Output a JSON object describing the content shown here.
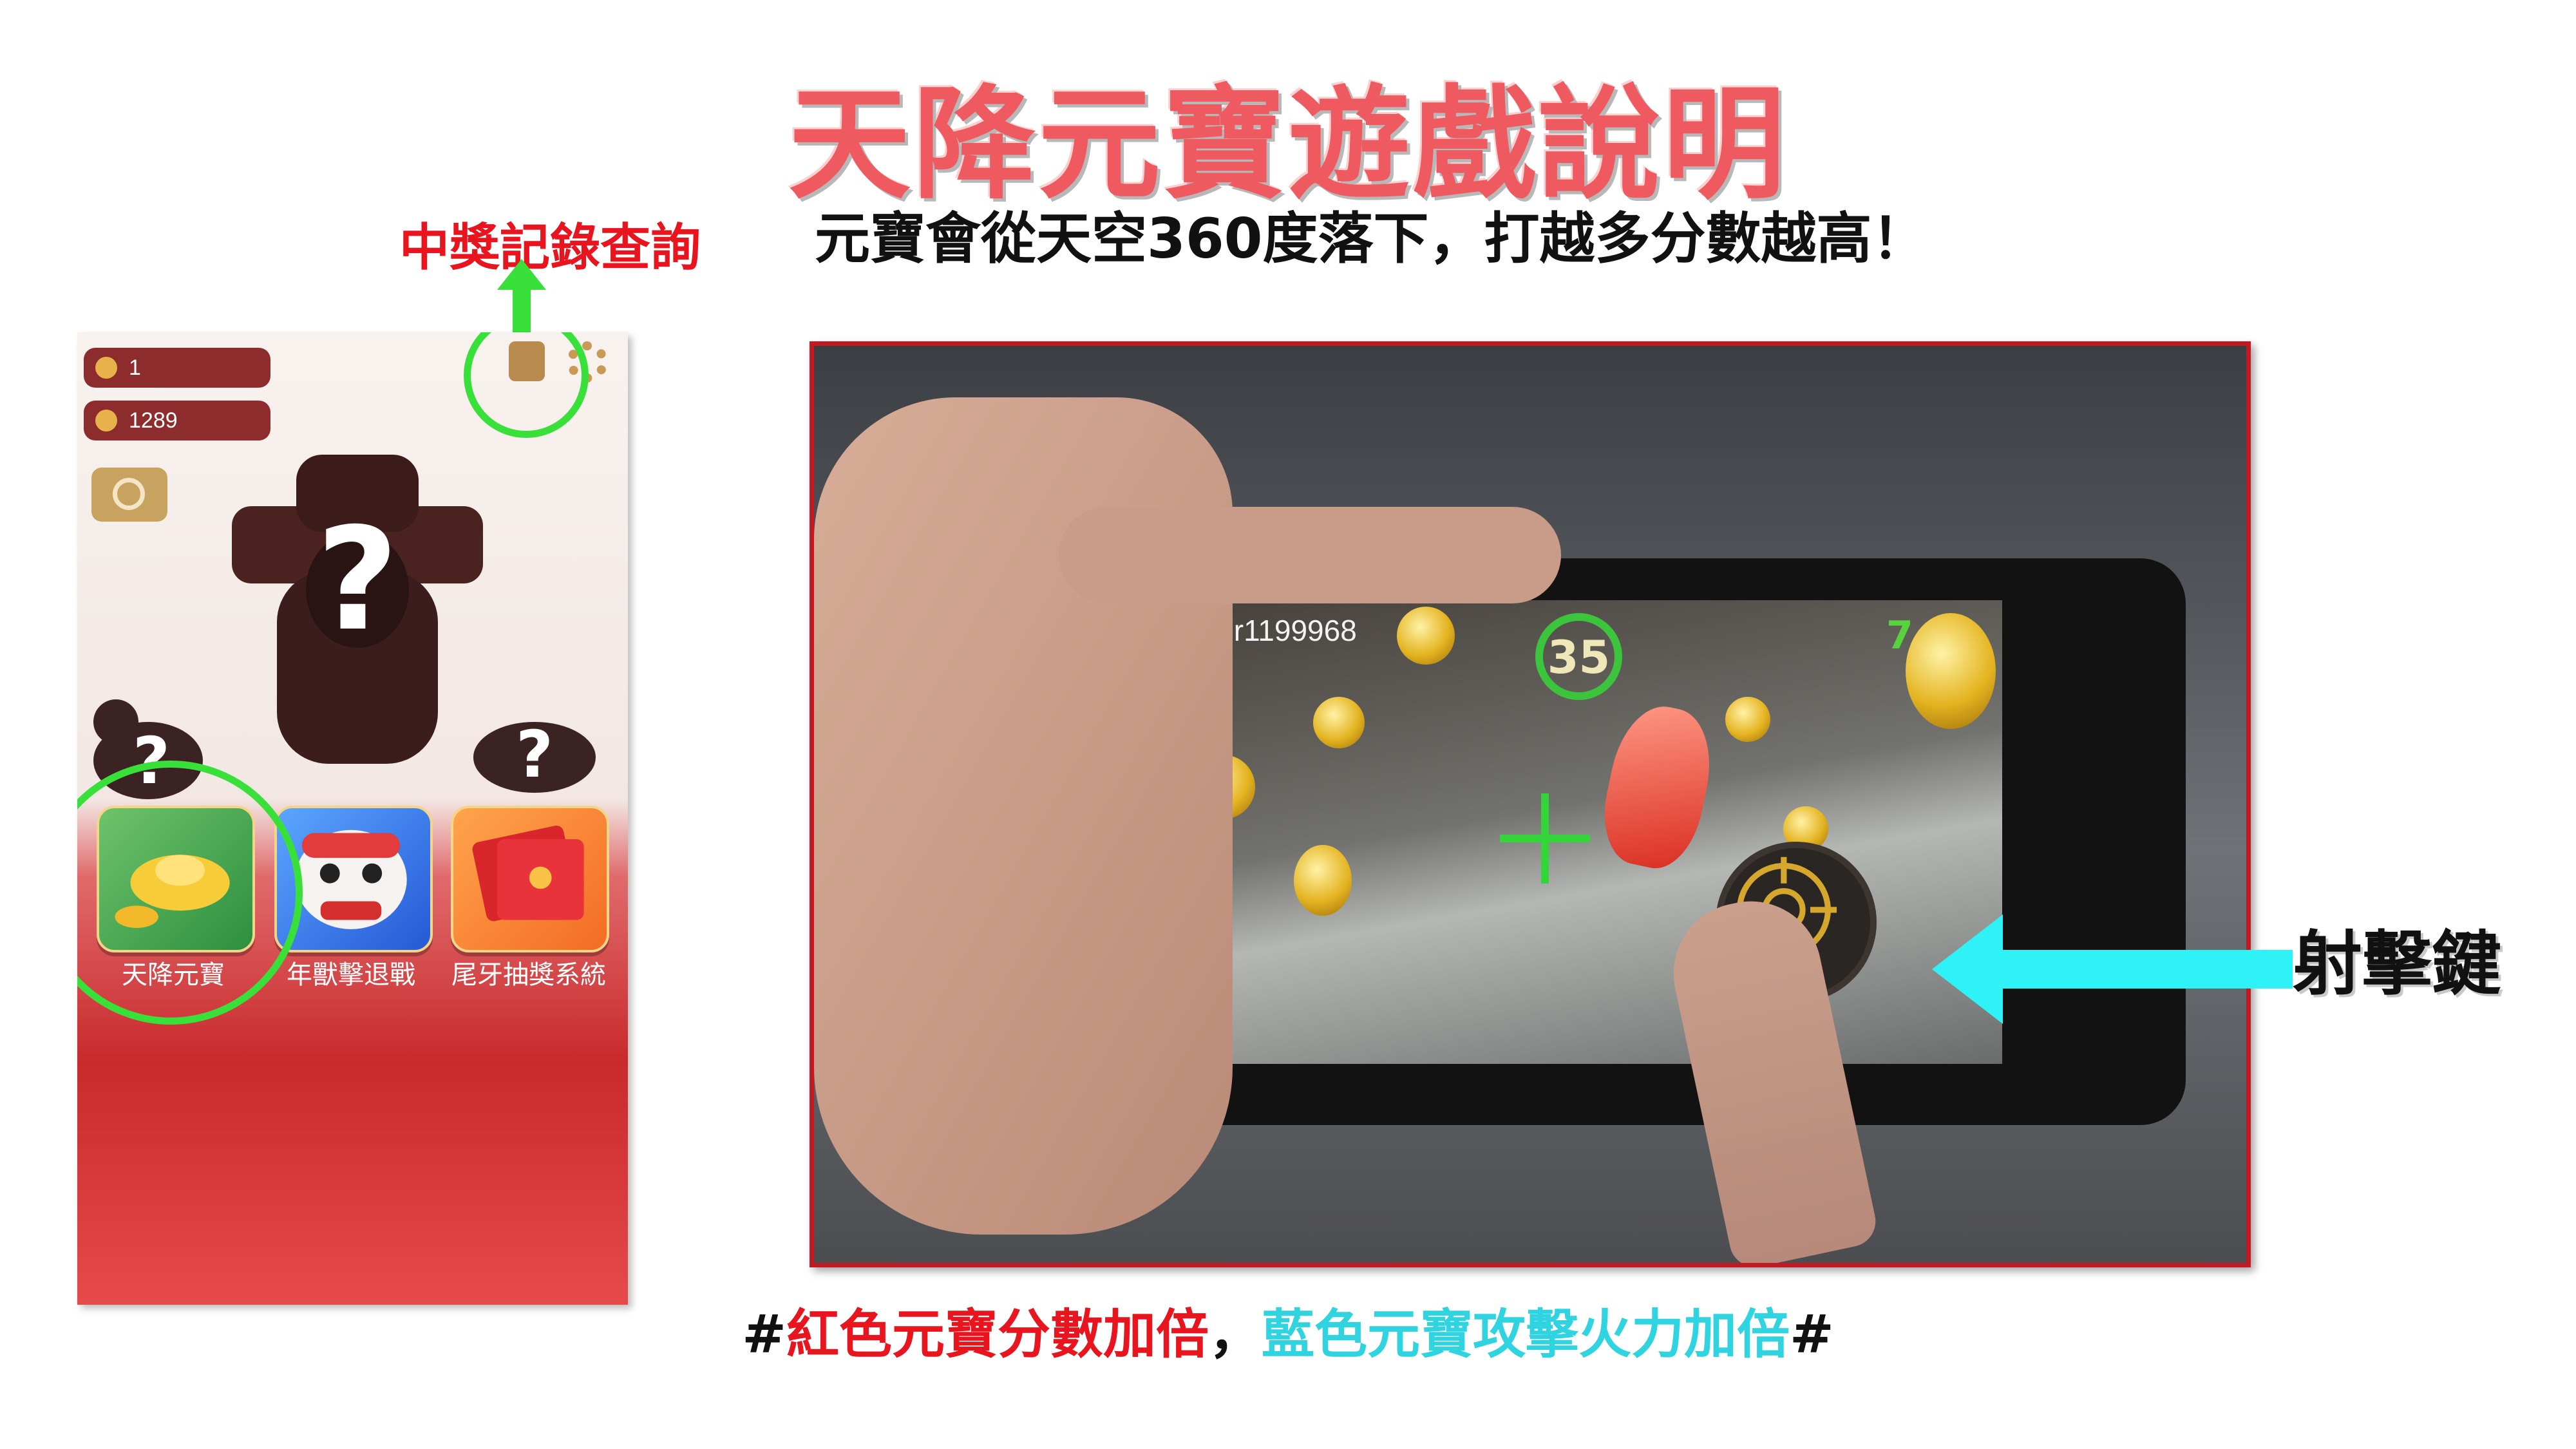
{
  "slide": {
    "title": "天降元寶遊戲說明",
    "subtitle": "元寶會從天空360度落下，打越多分數越高！",
    "records_label": "中獎記錄查詢",
    "shoot_label": "射擊鍵",
    "bottom_note": {
      "hash_open": "#",
      "red_part": "紅色元寶分數加倍",
      "separator": "，",
      "cyan_part": "藍色元寶攻擊火力加倍",
      "hash_close": "#"
    }
  },
  "home_screen": {
    "players": "1",
    "coins": "1289",
    "apps": [
      {
        "label": "天降元寶",
        "icon": "gold-ingot-icon"
      },
      {
        "label": "年獸擊退戰",
        "icon": "lion-dance-icon"
      },
      {
        "label": "尾牙抽獎系統",
        "icon": "red-envelope-icon"
      }
    ],
    "question_marks": [
      "?",
      "?",
      "?"
    ]
  },
  "ar_game": {
    "user": "User1199968",
    "timer": "35",
    "score": "7"
  },
  "colors": {
    "title": "#ee5a60",
    "highlight_green": "#39e03a",
    "arrow_cyan": "#2ef2f5",
    "photo_border": "#c21a22",
    "emphasis_red": "#e8141e",
    "emphasis_cyan": "#2fd4e0"
  }
}
